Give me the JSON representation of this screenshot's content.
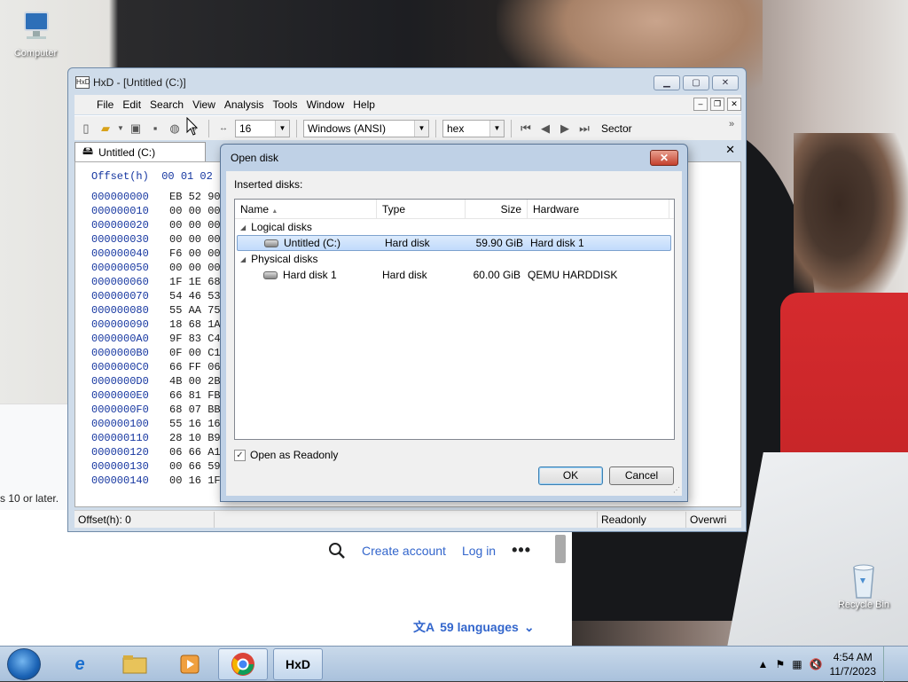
{
  "desktop": {
    "icons": [
      {
        "label": "Computer"
      },
      {
        "label": "Recycle Bin"
      }
    ]
  },
  "browser": {
    "fragment": "s 10 or later.",
    "create_account": "Create account",
    "log_in": "Log in",
    "more": "•••",
    "languages": "59 languages"
  },
  "hxd": {
    "title": "HxD - [Untitled (C:)]",
    "menu": [
      "File",
      "Edit",
      "Search",
      "View",
      "Analysis",
      "Tools",
      "Window",
      "Help"
    ],
    "toolbar": {
      "bytes_per_row": "16",
      "charset": "Windows (ANSI)",
      "number_base": "hex",
      "sector_label": "Sector"
    },
    "tab": "Untitled (C:)",
    "hex_header": "Offset(h)  00 01 02",
    "rows": [
      {
        "off": "000000000",
        "bytes": "EB 52 90"
      },
      {
        "off": "000000010",
        "bytes": "00 00 00"
      },
      {
        "off": "000000020",
        "bytes": "00 00 00"
      },
      {
        "off": "000000030",
        "bytes": "00 00 00"
      },
      {
        "off": "000000040",
        "bytes": "F6 00 00"
      },
      {
        "off": "000000050",
        "bytes": "00 00 00"
      },
      {
        "off": "000000060",
        "bytes": "1F 1E 68"
      },
      {
        "off": "000000070",
        "bytes": "54 46 53"
      },
      {
        "off": "000000080",
        "bytes": "55 AA 75"
      },
      {
        "off": "000000090",
        "bytes": "18 68 1A"
      },
      {
        "off": "0000000A0",
        "bytes": "9F 83 C4"
      },
      {
        "off": "0000000B0",
        "bytes": "0F 00 C1"
      },
      {
        "off": "0000000C0",
        "bytes": "66 FF 06"
      },
      {
        "off": "0000000D0",
        "bytes": "4B 00 2B"
      },
      {
        "off": "0000000E0",
        "bytes": "66 81 FB"
      },
      {
        "off": "0000000F0",
        "bytes": "68 07 BB"
      },
      {
        "off": "000000100",
        "bytes": "55 16 16"
      },
      {
        "off": "000000110",
        "bytes": "28 10 B9"
      },
      {
        "off": "000000120",
        "bytes": "06 66 A1"
      },
      {
        "off": "000000130",
        "bytes": "00 66 59"
      },
      {
        "off": "000000140",
        "bytes": "00 16 1F"
      }
    ],
    "status": {
      "offset": "Offset(h): 0",
      "mode": "Readonly",
      "overwrite": "Overwri"
    }
  },
  "open_disk": {
    "title": "Open disk",
    "inserted_label": "Inserted disks:",
    "columns": {
      "name": "Name",
      "type": "Type",
      "size": "Size",
      "hardware": "Hardware"
    },
    "groups": [
      {
        "label": "Logical disks",
        "items": [
          {
            "name": "Untitled (C:)",
            "type": "Hard disk",
            "size": "59.90 GiB",
            "hardware": "Hard disk 1",
            "selected": true
          }
        ]
      },
      {
        "label": "Physical disks",
        "items": [
          {
            "name": "Hard disk 1",
            "type": "Hard disk",
            "size": "60.00 GiB",
            "hardware": "QEMU HARDDISK",
            "selected": false
          }
        ]
      }
    ],
    "readonly_label": "Open as Readonly",
    "readonly_checked": true,
    "ok": "OK",
    "cancel": "Cancel"
  },
  "taskbar": {
    "time": "4:54 AM",
    "date": "11/7/2023"
  }
}
